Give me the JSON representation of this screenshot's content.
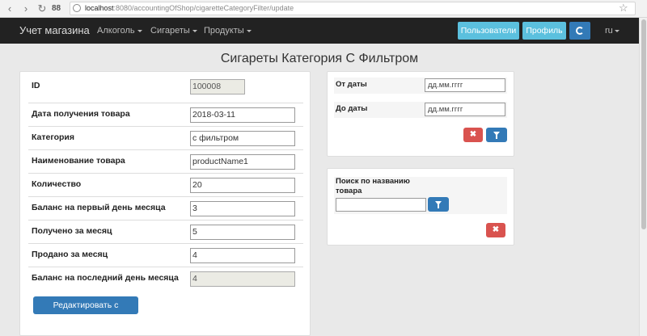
{
  "browser": {
    "url_host": "localhost",
    "url_path": ":8080/accountingOfShop/cigaretteCategoryFilter/update",
    "grid_label": "88"
  },
  "navbar": {
    "brand": "Учет магазина",
    "menus": [
      "Алкоголь",
      "Сигареты",
      "Продукты"
    ],
    "users_button": "Пользователи",
    "profile_button": "Профиль",
    "language": "ru"
  },
  "page_title": "Сигареты Категория С Фильтром",
  "form": {
    "fields": [
      {
        "label": "ID",
        "value": "100008",
        "readonly": true
      },
      {
        "label": "Дата получения товара",
        "value": "2018-03-11",
        "readonly": false
      },
      {
        "label": "Категория",
        "value": "с фильтром",
        "readonly": false
      },
      {
        "label": "Наименование товара",
        "value": "productName1",
        "readonly": false
      },
      {
        "label": "Количество",
        "value": "20",
        "readonly": false
      },
      {
        "label": "Баланс на первый день месяца",
        "value": "3",
        "readonly": false
      },
      {
        "label": "Получено за месяц",
        "value": "5",
        "readonly": false
      },
      {
        "label": "Продано за месяц",
        "value": "4",
        "readonly": false
      },
      {
        "label": "Баланс на последний день месяца",
        "value": "4",
        "readonly": true
      }
    ],
    "submit_label": "Редактировать с фильтром"
  },
  "date_filter": {
    "from_label": "От даты",
    "from_placeholder": "дд.мм.гггг",
    "to_label": "До даты",
    "to_placeholder": "дд.мм.гггг",
    "clear_icon": "close-icon",
    "filter_icon": "filter-icon"
  },
  "name_search": {
    "label": "Поиск по названию товара",
    "value": "",
    "filter_icon": "filter-icon",
    "clear_icon": "close-icon"
  }
}
